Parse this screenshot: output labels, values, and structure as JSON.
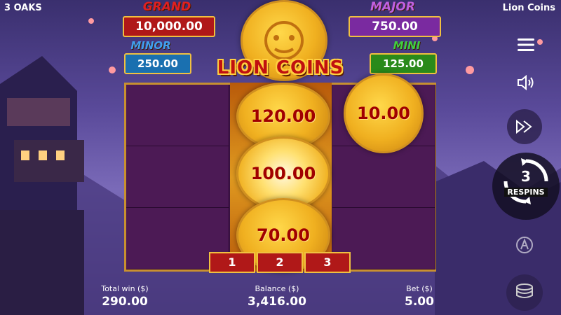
{
  "header": {
    "provider": "3 OAKS",
    "game_title": "Lion Coins"
  },
  "jackpots": {
    "grand": {
      "label": "GRAND",
      "value": "10,000.00",
      "color": "#b01818"
    },
    "major": {
      "label": "MAJOR",
      "value": "750.00",
      "color": "#7a2aa0"
    },
    "minor": {
      "label": "MINOR",
      "value": "250.00",
      "color": "#1a70b0"
    },
    "mini": {
      "label": "MINI",
      "value": "125.00",
      "color": "#2a8a1a"
    }
  },
  "logo_text": "LION COINS",
  "coins": {
    "c1": "120.00",
    "c2": "10.00",
    "c3": "100.00",
    "c4": "70.00"
  },
  "respin_positions": [
    "1",
    "2",
    "3"
  ],
  "footer": {
    "total_win_label": "Total win ($)",
    "total_win_value": "290.00",
    "balance_label": "Balance ($)",
    "balance_value": "3,416.00",
    "bet_label": "Bet ($)",
    "bet_value": "5.00"
  },
  "respins": {
    "count": "3",
    "label": "RESPINS"
  },
  "icons": [
    "menu-icon",
    "sound-icon",
    "fast-forward-icon",
    "respin-counter-icon",
    "autoplay-icon",
    "coin-stack-icon"
  ],
  "accent_colors": {
    "gold": "#f0c040",
    "red": "#b01818",
    "purple_cell": "#4c1a55"
  }
}
